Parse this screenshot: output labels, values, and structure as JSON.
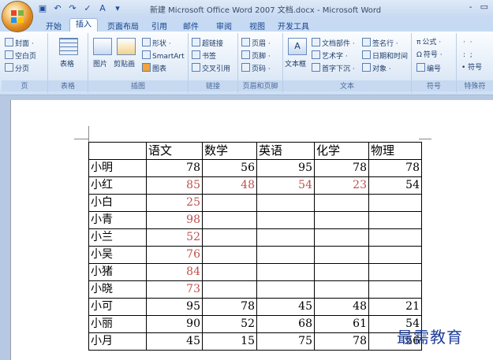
{
  "window": {
    "title": "新建 Microsoft Office Word 2007 文档.docx - Microsoft Word",
    "controls": [
      "-",
      "▭"
    ]
  },
  "tabs": [
    {
      "label": "开始",
      "active": false
    },
    {
      "label": "插入",
      "active": true
    },
    {
      "label": "页面布局",
      "active": false
    },
    {
      "label": "引用",
      "active": false
    },
    {
      "label": "邮件",
      "active": false
    },
    {
      "label": "审阅",
      "active": false
    },
    {
      "label": "视图",
      "active": false
    },
    {
      "label": "开发工具",
      "active": false
    }
  ],
  "ribbon": {
    "pages": {
      "items": [
        "封面 ·",
        "空白页",
        "分页"
      ],
      "label": "页"
    },
    "tables": {
      "items": [
        "表格"
      ],
      "label": "表格"
    },
    "illustrations": {
      "items": [
        "图片",
        "剪贴画",
        "形状 ·",
        "SmartArt",
        "图表"
      ],
      "label": "插图"
    },
    "links": {
      "items": [
        "超链接",
        "书签",
        "交叉引用"
      ],
      "label": "链接"
    },
    "header_footer": {
      "items": [
        "页眉 ·",
        "页脚 ·",
        "页码 ·"
      ],
      "label": "页眉和页脚"
    },
    "text": {
      "items": [
        "文本框",
        "文档部件 ·",
        "艺术字 ·",
        "首字下沉 ·",
        "签名行 ·",
        "日期和时间",
        "对象 ·"
      ],
      "label": "文本"
    },
    "symbols": {
      "items": [
        "公式 ·",
        "符号 ·",
        "编号"
      ],
      "label": "符号"
    },
    "special": {
      "items": [
        "符号"
      ],
      "label": "特殊符"
    }
  },
  "table": {
    "headers": [
      "",
      "语文",
      "数学",
      "英语",
      "化学",
      "物理"
    ],
    "rows": [
      {
        "name": "小明",
        "cells": [
          "78",
          "56",
          "95",
          "78",
          "78"
        ],
        "red": [
          false,
          false,
          false,
          false,
          false
        ]
      },
      {
        "name": "小红",
        "cells": [
          "85",
          "48",
          "54",
          "23",
          "54"
        ],
        "red": [
          true,
          true,
          true,
          true,
          false
        ]
      },
      {
        "name": "小白",
        "cells": [
          "25",
          "",
          "",
          "",
          ""
        ],
        "red": [
          true,
          false,
          false,
          false,
          false
        ]
      },
      {
        "name": "小青",
        "cells": [
          "98",
          "",
          "",
          "",
          ""
        ],
        "red": [
          true,
          false,
          false,
          false,
          false
        ]
      },
      {
        "name": "小兰",
        "cells": [
          "52",
          "",
          "",
          "",
          ""
        ],
        "red": [
          true,
          false,
          false,
          false,
          false
        ]
      },
      {
        "name": "小吴",
        "cells": [
          "76",
          "",
          "",
          "",
          ""
        ],
        "red": [
          true,
          false,
          false,
          false,
          false
        ]
      },
      {
        "name": "小猪",
        "cells": [
          "84",
          "",
          "",
          "",
          ""
        ],
        "red": [
          true,
          false,
          false,
          false,
          false
        ]
      },
      {
        "name": "小晓",
        "cells": [
          "73",
          "",
          "",
          "",
          ""
        ],
        "red": [
          true,
          false,
          false,
          false,
          false
        ]
      },
      {
        "name": "小可",
        "cells": [
          "95",
          "78",
          "45",
          "48",
          "21"
        ],
        "red": [
          false,
          false,
          false,
          false,
          false
        ]
      },
      {
        "name": "小丽",
        "cells": [
          "90",
          "52",
          "68",
          "61",
          "54"
        ],
        "red": [
          false,
          false,
          false,
          false,
          false
        ]
      },
      {
        "name": "小月",
        "cells": [
          "45",
          "15",
          "75",
          "78",
          "56"
        ],
        "red": [
          false,
          false,
          false,
          false,
          false
        ]
      }
    ]
  },
  "watermark": "最需教育",
  "colors": {
    "red_text": "#c0504d",
    "ribbon_bg": "#dfeaf7",
    "tab_text": "#15428b"
  }
}
